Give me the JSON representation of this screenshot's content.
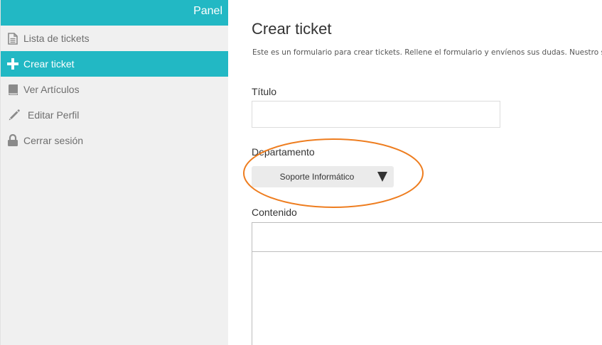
{
  "sidebar": {
    "header": "Panel",
    "items": [
      {
        "label": "Lista de tickets",
        "icon": "file-text-icon",
        "active": false
      },
      {
        "label": "Crear ticket",
        "icon": "plus-icon",
        "active": true
      },
      {
        "label": "Ver Artículos",
        "icon": "book-icon",
        "active": false
      },
      {
        "label": "Editar Perfil",
        "icon": "pencil-icon",
        "active": false
      },
      {
        "label": "Cerrar sesión",
        "icon": "lock-icon",
        "active": false
      }
    ]
  },
  "main": {
    "title": "Crear ticket",
    "description": "Este es un formulario para crear tickets. Rellene el formulario y envíenos sus dudas. Nuestro s",
    "fields": {
      "titulo": {
        "label": "Título",
        "value": ""
      },
      "departamento": {
        "label": "Departamento",
        "selected": "Soporte Informático"
      },
      "contenido": {
        "label": "Contenido"
      }
    }
  },
  "colors": {
    "accent": "#22b8c4",
    "highlight": "#ee7d1f",
    "sidebar_bg": "#f0f0f0",
    "icon_gray": "#8a8a8a"
  }
}
